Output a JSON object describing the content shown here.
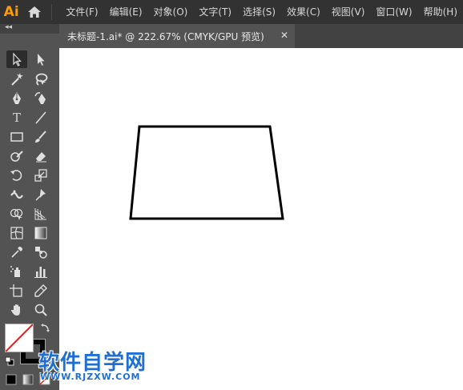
{
  "app": {
    "logo": "Ai",
    "accent_color": "#ff9a00"
  },
  "menu": {
    "items": [
      {
        "label": "文件(F)"
      },
      {
        "label": "编辑(E)"
      },
      {
        "label": "对象(O)"
      },
      {
        "label": "文字(T)"
      },
      {
        "label": "选择(S)"
      },
      {
        "label": "效果(C)"
      },
      {
        "label": "视图(V)"
      },
      {
        "label": "窗口(W)"
      },
      {
        "label": "帮助(H)"
      }
    ]
  },
  "toolbar": {
    "collapse_glyph": "◂◂",
    "tools": [
      {
        "name": "selection-tool",
        "icon": "arrow-icon",
        "active": true
      },
      {
        "name": "direct-selection-tool",
        "icon": "arrow-filled-icon"
      },
      {
        "name": "magic-wand-tool",
        "icon": "magic-wand-icon"
      },
      {
        "name": "lasso-tool",
        "icon": "lasso-icon"
      },
      {
        "name": "pen-tool",
        "icon": "pen-icon"
      },
      {
        "name": "curvature-tool",
        "icon": "curvature-icon"
      },
      {
        "name": "type-tool",
        "icon": "type-icon",
        "glyph": "T"
      },
      {
        "name": "line-segment-tool",
        "icon": "line-icon"
      },
      {
        "name": "rectangle-tool",
        "icon": "rectangle-icon"
      },
      {
        "name": "paintbrush-tool",
        "icon": "brush-icon"
      },
      {
        "name": "shaper-tool",
        "icon": "shaper-icon"
      },
      {
        "name": "eraser-tool",
        "icon": "eraser-icon"
      },
      {
        "name": "rotate-tool",
        "icon": "rotate-icon"
      },
      {
        "name": "scale-tool",
        "icon": "scale-icon"
      },
      {
        "name": "width-tool",
        "icon": "width-icon"
      },
      {
        "name": "puppet-warp-tool",
        "icon": "pin-icon"
      },
      {
        "name": "shape-builder-tool",
        "icon": "shape-builder-icon"
      },
      {
        "name": "perspective-grid-tool",
        "icon": "perspective-icon"
      },
      {
        "name": "mesh-tool",
        "icon": "mesh-icon"
      },
      {
        "name": "gradient-tool",
        "icon": "gradient-icon"
      },
      {
        "name": "eyedropper-tool",
        "icon": "eyedropper-icon"
      },
      {
        "name": "blend-tool",
        "icon": "blend-icon"
      },
      {
        "name": "symbol-sprayer-tool",
        "icon": "symbol-sprayer-icon"
      },
      {
        "name": "column-graph-tool",
        "icon": "bar-chart-icon"
      },
      {
        "name": "artboard-tool",
        "icon": "artboard-icon"
      },
      {
        "name": "slice-tool",
        "icon": "slice-icon"
      },
      {
        "name": "hand-tool",
        "icon": "hand-icon"
      },
      {
        "name": "zoom-tool",
        "icon": "zoom-icon"
      }
    ],
    "fill": "none",
    "stroke": "#000000"
  },
  "document": {
    "tab_title": "未标题-1.ai* @ 222.67% (CMYK/GPU 预览)",
    "close_glyph": "✕"
  },
  "artwork": {
    "shape": "trapezoid",
    "stroke_color": "#000000",
    "fill": "none"
  },
  "watermark": {
    "title": "软件自学网",
    "url": "WWW.RJZXW.COM",
    "color": "#1f6ed4"
  }
}
